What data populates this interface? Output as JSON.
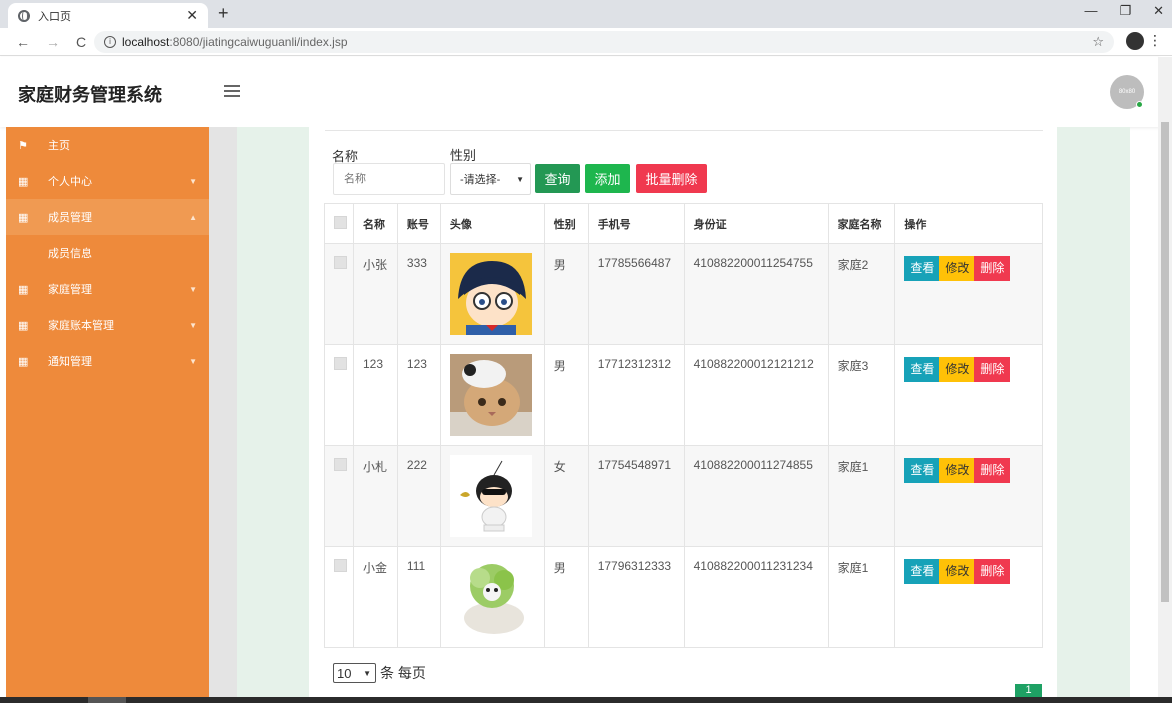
{
  "browser": {
    "tab_title": "入口页",
    "url_host": "localhost",
    "url_rest": ":8080/jiatingcaiwuguanli/index.jsp"
  },
  "app": {
    "brand": "家庭财务管理系统",
    "avatar_text": "80x80"
  },
  "sidebar": {
    "items": [
      {
        "label": "主页",
        "icon": "flag-icon"
      },
      {
        "label": "个人中心",
        "icon": "grid-icon"
      },
      {
        "label": "成员管理",
        "icon": "grid-icon"
      },
      {
        "label": "成员信息"
      },
      {
        "label": "家庭管理",
        "icon": "grid-icon"
      },
      {
        "label": "家庭账本管理",
        "icon": "grid-icon"
      },
      {
        "label": "通知管理",
        "icon": "grid-icon"
      }
    ]
  },
  "filters": {
    "name_label": "名称",
    "name_placeholder": "名称",
    "gender_label": "性别",
    "gender_selected": "-请选择-",
    "query_button": "查询",
    "add_button": "添加",
    "batch_delete_button": "批量删除"
  },
  "table": {
    "headers": [
      "名称",
      "账号",
      "头像",
      "性别",
      "手机号",
      "身份证",
      "家庭名称",
      "操作"
    ],
    "rows": [
      {
        "name": "小张",
        "account": "333",
        "gender": "男",
        "phone": "17785566487",
        "id_card": "410882200011254755",
        "family": "家庭2",
        "avatar": "cartoon-boy-with-glasses"
      },
      {
        "name": "123",
        "account": "123",
        "gender": "男",
        "phone": "17712312312",
        "id_card": "410882200012121212",
        "family": "家庭3",
        "avatar": "cat-photo"
      },
      {
        "name": "小札",
        "account": "222",
        "gender": "女",
        "phone": "17754548971",
        "id_card": "410882200011274855",
        "family": "家庭1",
        "avatar": "cartoon-kid-with-sunglasses"
      },
      {
        "name": "小金",
        "account": "111",
        "gender": "男",
        "phone": "17796312333",
        "id_card": "410882200011231234",
        "family": "家庭1",
        "avatar": "cabbage-dog"
      }
    ],
    "actions": {
      "view": "查看",
      "edit": "修改",
      "delete": "删除"
    }
  },
  "pagination": {
    "page_size": "10",
    "suffix": "条 每页",
    "current_page": "1"
  },
  "colors": {
    "sidebar": "#ee8a3b",
    "view": "#17a2b8",
    "edit": "#ffc107",
    "delete": "#f0394f",
    "query": "#239854",
    "add": "#1eb64e",
    "batch_delete": "#f0394f"
  }
}
